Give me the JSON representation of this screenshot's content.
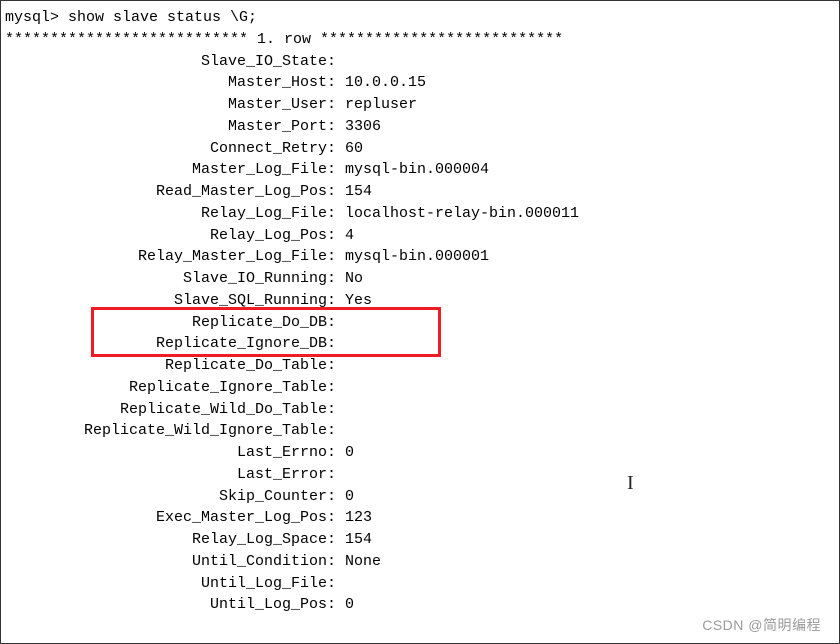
{
  "prompt": "mysql> show slave status \\G;",
  "row_header": "*************************** 1. row ***************************",
  "fields": [
    {
      "key": "Slave_IO_State",
      "value": ""
    },
    {
      "key": "Master_Host",
      "value": "10.0.0.15"
    },
    {
      "key": "Master_User",
      "value": "repluser"
    },
    {
      "key": "Master_Port",
      "value": "3306"
    },
    {
      "key": "Connect_Retry",
      "value": "60"
    },
    {
      "key": "Master_Log_File",
      "value": "mysql-bin.000004"
    },
    {
      "key": "Read_Master_Log_Pos",
      "value": "154"
    },
    {
      "key": "Relay_Log_File",
      "value": "localhost-relay-bin.000011"
    },
    {
      "key": "Relay_Log_Pos",
      "value": "4"
    },
    {
      "key": "Relay_Master_Log_File",
      "value": "mysql-bin.000001"
    },
    {
      "key": "Slave_IO_Running",
      "value": "No"
    },
    {
      "key": "Slave_SQL_Running",
      "value": "Yes"
    },
    {
      "key": "Replicate_Do_DB",
      "value": ""
    },
    {
      "key": "Replicate_Ignore_DB",
      "value": ""
    },
    {
      "key": "Replicate_Do_Table",
      "value": ""
    },
    {
      "key": "Replicate_Ignore_Table",
      "value": ""
    },
    {
      "key": "Replicate_Wild_Do_Table",
      "value": ""
    },
    {
      "key": "Replicate_Wild_Ignore_Table",
      "value": ""
    },
    {
      "key": "Last_Errno",
      "value": "0"
    },
    {
      "key": "Last_Error",
      "value": ""
    },
    {
      "key": "Skip_Counter",
      "value": "0"
    },
    {
      "key": "Exec_Master_Log_Pos",
      "value": "123"
    },
    {
      "key": "Relay_Log_Space",
      "value": "154"
    },
    {
      "key": "Until_Condition",
      "value": "None"
    },
    {
      "key": "Until_Log_File",
      "value": ""
    },
    {
      "key": "Until_Log_Pos",
      "value": "0"
    }
  ],
  "highlight_keys": [
    "Slave_IO_Running",
    "Slave_SQL_Running"
  ],
  "watermark": "CSDN @简明编程"
}
